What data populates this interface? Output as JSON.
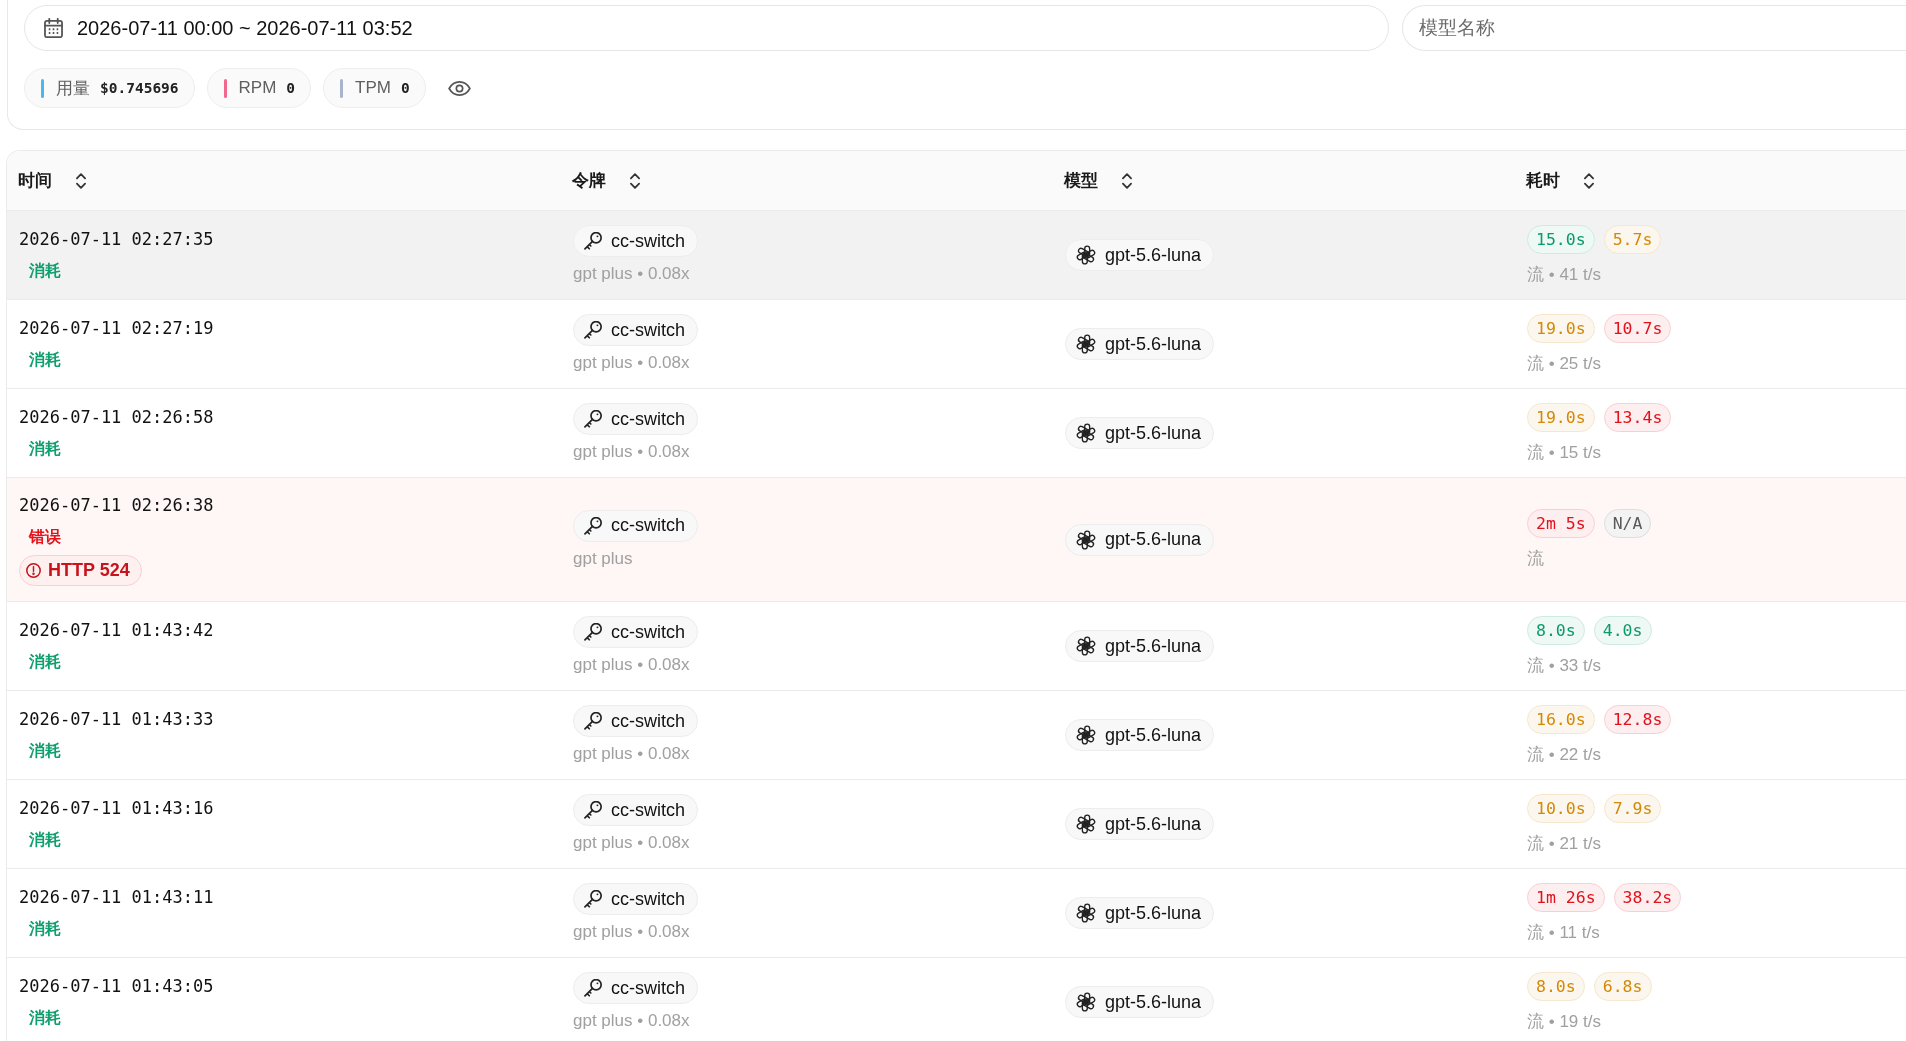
{
  "filters": {
    "date_range": {
      "value": "2026-07-11 00:00 ~ 2026-07-11 03:52"
    },
    "model_name": {
      "placeholder": "模型名称"
    }
  },
  "stats": [
    {
      "label": "用量",
      "value": "$0.745696",
      "color": "#4cb6ee"
    },
    {
      "label": "RPM",
      "value": "0",
      "color": "#f2678e"
    },
    {
      "label": "TPM",
      "value": "0",
      "color": "#a7b4cb"
    }
  ],
  "table": {
    "columns": [
      {
        "label": "时间"
      },
      {
        "label": "令牌"
      },
      {
        "label": "模型"
      },
      {
        "label": "耗时"
      }
    ],
    "rows": [
      {
        "kind": "success",
        "hovered": true,
        "time": "2026-07-11 02:27:35",
        "status": "消耗",
        "token": {
          "name": "cc-switch",
          "detail": "gpt plus • 0.08x"
        },
        "model": "gpt-5.6-luna",
        "durations": [
          {
            "value": "15.0s",
            "color": "#0b9a6b"
          },
          {
            "value": "5.7s",
            "color": "#d48806"
          }
        ],
        "stream_info": "流 • 41 t/s"
      },
      {
        "kind": "success",
        "hovered": false,
        "time": "2026-07-11 02:27:19",
        "status": "消耗",
        "token": {
          "name": "cc-switch",
          "detail": "gpt plus • 0.08x"
        },
        "model": "gpt-5.6-luna",
        "durations": [
          {
            "value": "19.0s",
            "color": "#d48806"
          },
          {
            "value": "10.7s",
            "color": "#e0121c"
          }
        ],
        "stream_info": "流 • 25 t/s"
      },
      {
        "kind": "success",
        "hovered": false,
        "time": "2026-07-11 02:26:58",
        "status": "消耗",
        "token": {
          "name": "cc-switch",
          "detail": "gpt plus • 0.08x"
        },
        "model": "gpt-5.6-luna",
        "durations": [
          {
            "value": "19.0s",
            "color": "#d48806"
          },
          {
            "value": "13.4s",
            "color": "#e0121c"
          }
        ],
        "stream_info": "流 • 15 t/s"
      },
      {
        "kind": "error",
        "hovered": false,
        "time": "2026-07-11 02:26:38",
        "status": "错误",
        "error_code": "HTTP 524",
        "token": {
          "name": "cc-switch",
          "detail": "gpt plus"
        },
        "model": "gpt-5.6-luna",
        "durations": [
          {
            "value": "2m 5s",
            "color": "#e0121c"
          },
          {
            "value": "N/A",
            "color": "#5a5a5a"
          }
        ],
        "stream_info": "流"
      },
      {
        "kind": "success",
        "hovered": false,
        "time": "2026-07-11 01:43:42",
        "status": "消耗",
        "token": {
          "name": "cc-switch",
          "detail": "gpt plus • 0.08x"
        },
        "model": "gpt-5.6-luna",
        "durations": [
          {
            "value": "8.0s",
            "color": "#0b9a6b"
          },
          {
            "value": "4.0s",
            "color": "#0b9a6b"
          }
        ],
        "stream_info": "流 • 33 t/s"
      },
      {
        "kind": "success",
        "hovered": false,
        "time": "2026-07-11 01:43:33",
        "status": "消耗",
        "token": {
          "name": "cc-switch",
          "detail": "gpt plus • 0.08x"
        },
        "model": "gpt-5.6-luna",
        "durations": [
          {
            "value": "16.0s",
            "color": "#d48806"
          },
          {
            "value": "12.8s",
            "color": "#e0121c"
          }
        ],
        "stream_info": "流 • 22 t/s"
      },
      {
        "kind": "success",
        "hovered": false,
        "time": "2026-07-11 01:43:16",
        "status": "消耗",
        "token": {
          "name": "cc-switch",
          "detail": "gpt plus • 0.08x"
        },
        "model": "gpt-5.6-luna",
        "durations": [
          {
            "value": "10.0s",
            "color": "#d48806"
          },
          {
            "value": "7.9s",
            "color": "#d48806"
          }
        ],
        "stream_info": "流 • 21 t/s"
      },
      {
        "kind": "success",
        "hovered": false,
        "time": "2026-07-11 01:43:11",
        "status": "消耗",
        "token": {
          "name": "cc-switch",
          "detail": "gpt plus • 0.08x"
        },
        "model": "gpt-5.6-luna",
        "durations": [
          {
            "value": "1m 26s",
            "color": "#e0121c"
          },
          {
            "value": "38.2s",
            "color": "#e0121c"
          }
        ],
        "stream_info": "流 • 11 t/s"
      },
      {
        "kind": "success",
        "hovered": false,
        "time": "2026-07-11 01:43:05",
        "status": "消耗",
        "token": {
          "name": "cc-switch",
          "detail": "gpt plus • 0.08x"
        },
        "model": "gpt-5.6-luna",
        "durations": [
          {
            "value": "8.0s",
            "color": "#d48806"
          },
          {
            "value": "6.8s",
            "color": "#d48806"
          }
        ],
        "stream_info": "流 • 19 t/s"
      }
    ]
  }
}
